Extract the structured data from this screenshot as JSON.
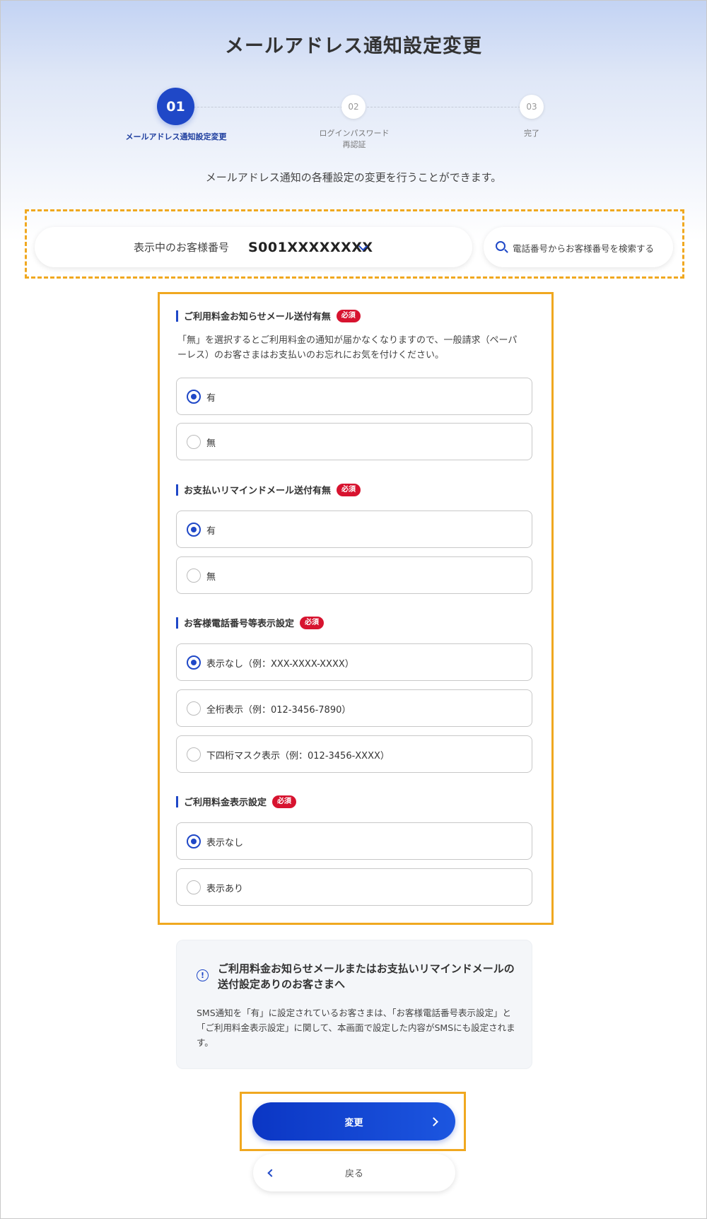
{
  "page": {
    "title": "メールアドレス通知設定変更",
    "subtitle": "メールアドレス通知の各種設定の変更を行うことができます。"
  },
  "stepper": {
    "steps": [
      {
        "number": "01",
        "label": "メールアドレス通知設定変更",
        "state": "active"
      },
      {
        "number": "02",
        "label_line1": "ログインパスワード",
        "label_line2": "再認証",
        "state": "inactive"
      },
      {
        "number": "03",
        "label": "完了",
        "state": "inactive"
      }
    ]
  },
  "customer": {
    "label": "表示中のお客様番号",
    "number": "S001XXXXXXXX",
    "search_label": "電話番号からお客様番号を検索する"
  },
  "required_badge": "必須",
  "sections": [
    {
      "title": "ご利用料金お知らせメール送付有無",
      "description_line1": "「無」を選択するとご利用料金の通知が届かなくなりますので、一般請求（ペーパ",
      "description_line2": "ーレス）のお客さまはお支払いのお忘れにお気を付けください。",
      "options": [
        {
          "label": "有",
          "selected": true
        },
        {
          "label": "無",
          "selected": false
        }
      ]
    },
    {
      "title": "お支払いリマインドメール送付有無",
      "options": [
        {
          "label": "有",
          "selected": true
        },
        {
          "label": "無",
          "selected": false
        }
      ]
    },
    {
      "title": "お客様電話番号等表示設定",
      "options": [
        {
          "label": "表示なし（例：XXX-XXXX-XXXX）",
          "selected": true
        },
        {
          "label": "全桁表示（例：012-3456-7890）",
          "selected": false
        },
        {
          "label": "下四桁マスク表示（例：012-3456-XXXX）",
          "selected": false
        }
      ]
    },
    {
      "title": "ご利用料金表示設定",
      "options": [
        {
          "label": "表示なし",
          "selected": true
        },
        {
          "label": "表示あり",
          "selected": false
        }
      ]
    }
  ],
  "notice": {
    "icon": "info-icon",
    "title": "ご利用料金お知らせメールまたはお支払いリマインドメールの送付設定ありのお客さまへ",
    "body": "SMS通知を「有」に設定されているお客さまは、「お客様電話番号表示設定」と「ご利用料金表示設定」に関して、本画面で設定した内容がSMSにも設定されます。"
  },
  "buttons": {
    "submit_label": "変更",
    "back_label": "戻る"
  },
  "colors": {
    "accent": "#1f48c7",
    "required": "#d7132f",
    "highlight": "#f0a820"
  }
}
